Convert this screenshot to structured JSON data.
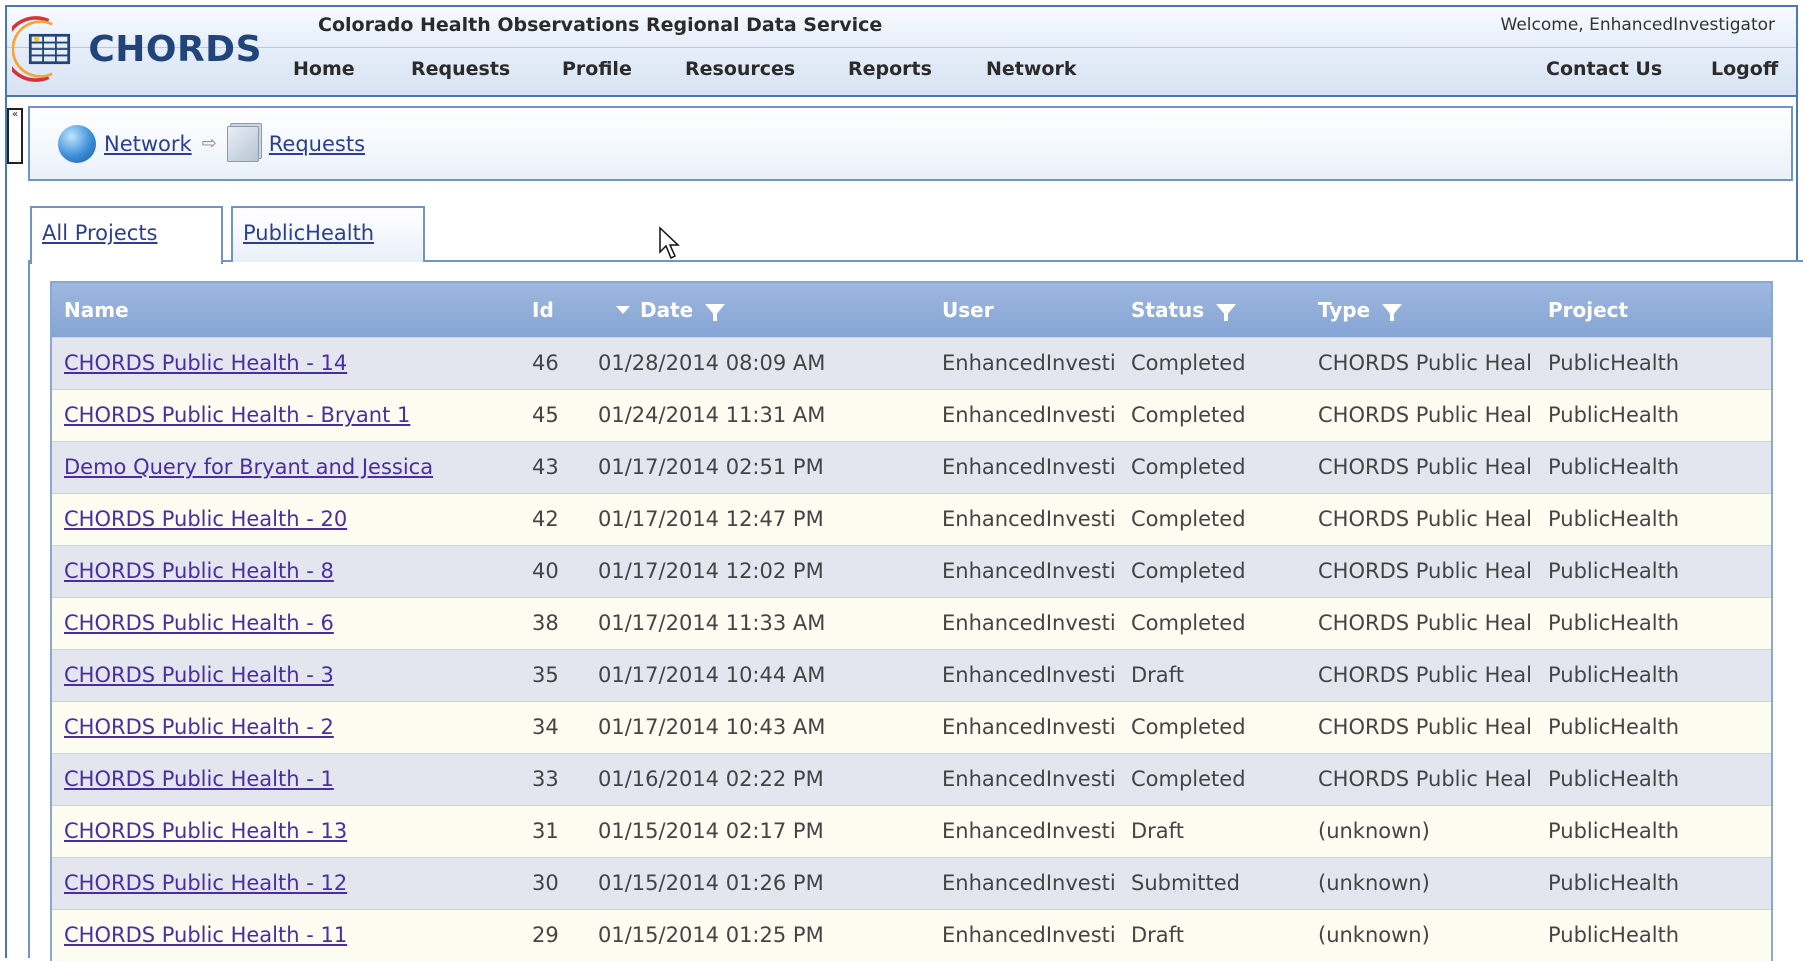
{
  "header": {
    "logo_text": "CHORDS",
    "app_title": "Colorado Health Observations Regional Data Service",
    "welcome": "Welcome, EnhancedInvestigator"
  },
  "nav": {
    "items": [
      "Home",
      "Requests",
      "Profile",
      "Resources",
      "Reports",
      "Network"
    ],
    "right_items": [
      "Contact Us",
      "Logoff"
    ]
  },
  "collapse_label": "«",
  "breadcrumb": {
    "items": [
      "Network",
      "Requests"
    ],
    "separator": "⇨"
  },
  "tabs": [
    {
      "label": "All Projects",
      "active": true
    },
    {
      "label": "PublicHealth",
      "active": false
    }
  ],
  "grid": {
    "columns": [
      "Name",
      "Id",
      "Date",
      "User",
      "Status",
      "Type",
      "Project"
    ],
    "rows": [
      {
        "name": "CHORDS Public Health - 14",
        "id": "46",
        "date": "01/28/2014 08:09 AM",
        "user": "EnhancedInvesti",
        "status": "Completed",
        "type": "CHORDS Public Heal",
        "project": "PublicHealth"
      },
      {
        "name": "CHORDS Public Health - Bryant 1",
        "id": "45",
        "date": "01/24/2014 11:31 AM",
        "user": "EnhancedInvesti",
        "status": "Completed",
        "type": "CHORDS Public Heal",
        "project": "PublicHealth"
      },
      {
        "name": "Demo Query for Bryant and Jessica",
        "id": "43",
        "date": "01/17/2014 02:51 PM",
        "user": "EnhancedInvesti",
        "status": "Completed",
        "type": "CHORDS Public Heal",
        "project": "PublicHealth"
      },
      {
        "name": "CHORDS Public Health - 20",
        "id": "42",
        "date": "01/17/2014 12:47 PM",
        "user": "EnhancedInvesti",
        "status": "Completed",
        "type": "CHORDS Public Heal",
        "project": "PublicHealth"
      },
      {
        "name": "CHORDS Public Health - 8",
        "id": "40",
        "date": "01/17/2014 12:02 PM",
        "user": "EnhancedInvesti",
        "status": "Completed",
        "type": "CHORDS Public Heal",
        "project": "PublicHealth"
      },
      {
        "name": "CHORDS Public Health - 6",
        "id": "38",
        "date": "01/17/2014 11:33 AM",
        "user": "EnhancedInvesti",
        "status": "Completed",
        "type": "CHORDS Public Heal",
        "project": "PublicHealth"
      },
      {
        "name": "CHORDS Public Health - 3",
        "id": "35",
        "date": "01/17/2014 10:44 AM",
        "user": "EnhancedInvesti",
        "status": "Draft",
        "type": "CHORDS Public Heal",
        "project": "PublicHealth"
      },
      {
        "name": "CHORDS Public Health - 2",
        "id": "34",
        "date": "01/17/2014 10:43 AM",
        "user": "EnhancedInvesti",
        "status": "Completed",
        "type": "CHORDS Public Heal",
        "project": "PublicHealth"
      },
      {
        "name": "CHORDS Public Health - 1",
        "id": "33",
        "date": "01/16/2014 02:22 PM",
        "user": "EnhancedInvesti",
        "status": "Completed",
        "type": "CHORDS Public Heal",
        "project": "PublicHealth"
      },
      {
        "name": "CHORDS Public Health - 13",
        "id": "31",
        "date": "01/15/2014 02:17 PM",
        "user": "EnhancedInvesti",
        "status": "Draft",
        "type": "(unknown)",
        "project": "PublicHealth"
      },
      {
        "name": "CHORDS Public Health - 12",
        "id": "30",
        "date": "01/15/2014 01:26 PM",
        "user": "EnhancedInvesti",
        "status": "Submitted",
        "type": "(unknown)",
        "project": "PublicHealth"
      },
      {
        "name": "CHORDS Public Health - 11",
        "id": "29",
        "date": "01/15/2014 01:25 PM",
        "user": "EnhancedInvesti",
        "status": "Draft",
        "type": "(unknown)",
        "project": "PublicHealth"
      }
    ]
  },
  "colors": {
    "frame_border": "#4a78b5",
    "grid_header": "#8fabd8",
    "link": "#4a2ea0",
    "row_odd": "#e3e6ef",
    "row_even": "#fdfcf1"
  }
}
